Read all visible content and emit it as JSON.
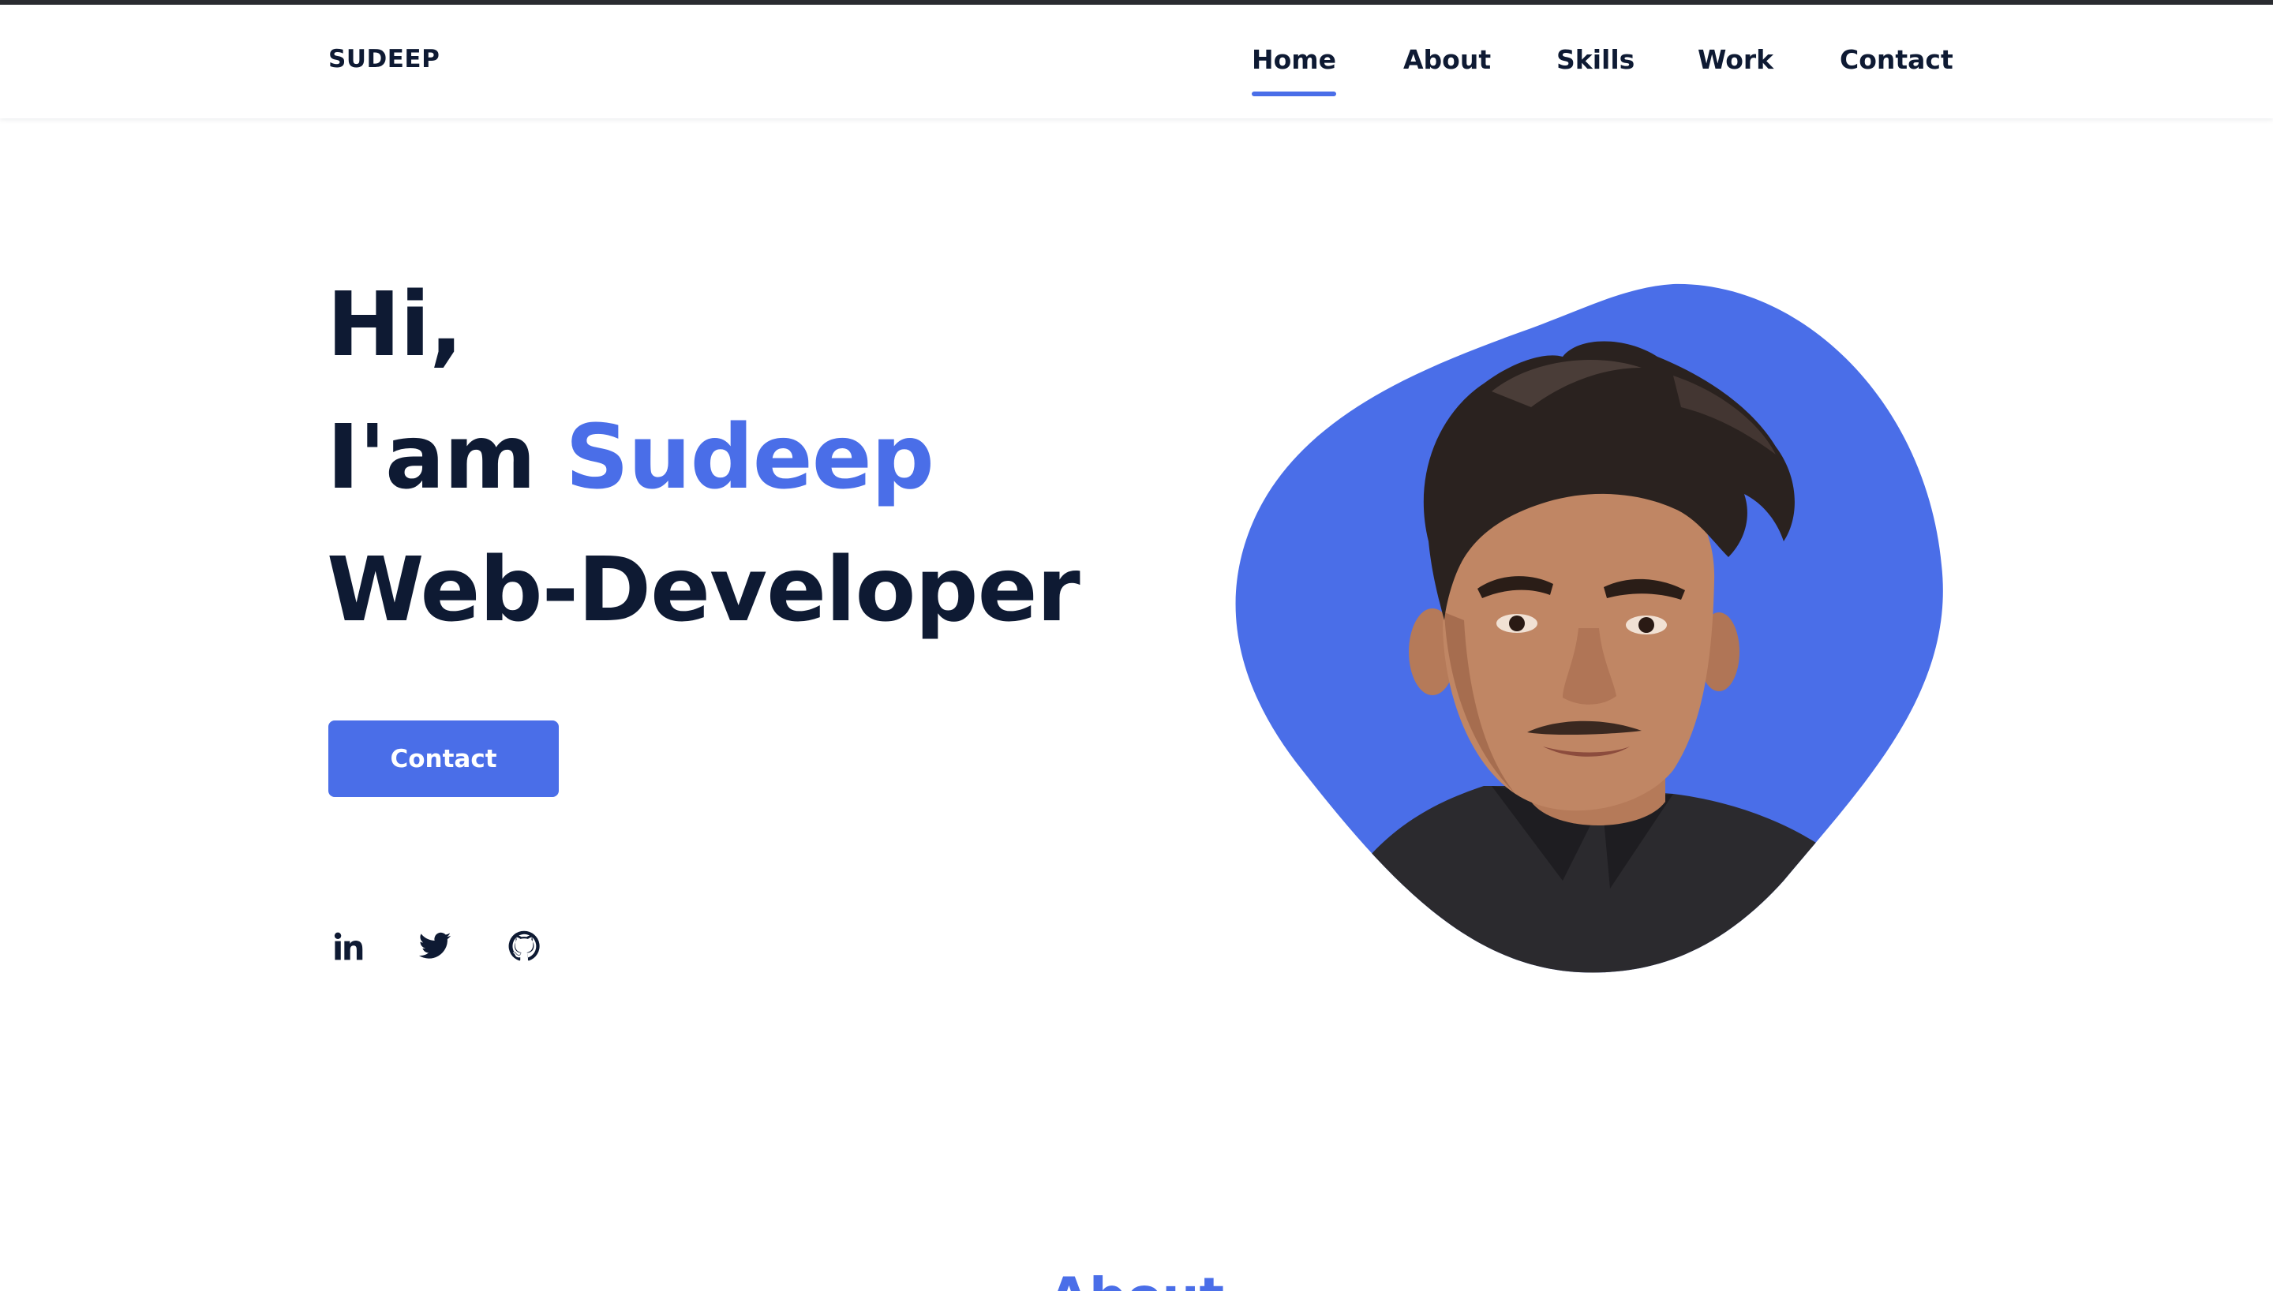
{
  "header": {
    "logo": "SUDEEP",
    "nav": [
      {
        "label": "Home",
        "active": true
      },
      {
        "label": "About",
        "active": false
      },
      {
        "label": "Skills",
        "active": false
      },
      {
        "label": "Work",
        "active": false
      },
      {
        "label": "Contact",
        "active": false
      }
    ]
  },
  "hero": {
    "greeting": "Hi,",
    "intro_prefix": "I'am ",
    "name": "Sudeep",
    "role": "Web-Developer",
    "contact_button": "Contact",
    "social_icons": [
      "linkedin-icon",
      "twitter-icon",
      "github-icon"
    ]
  },
  "about": {
    "title": "About"
  },
  "colors": {
    "accent": "#4a6ee8",
    "text": "#0e1a33",
    "top_strip": "#2a2c31"
  }
}
